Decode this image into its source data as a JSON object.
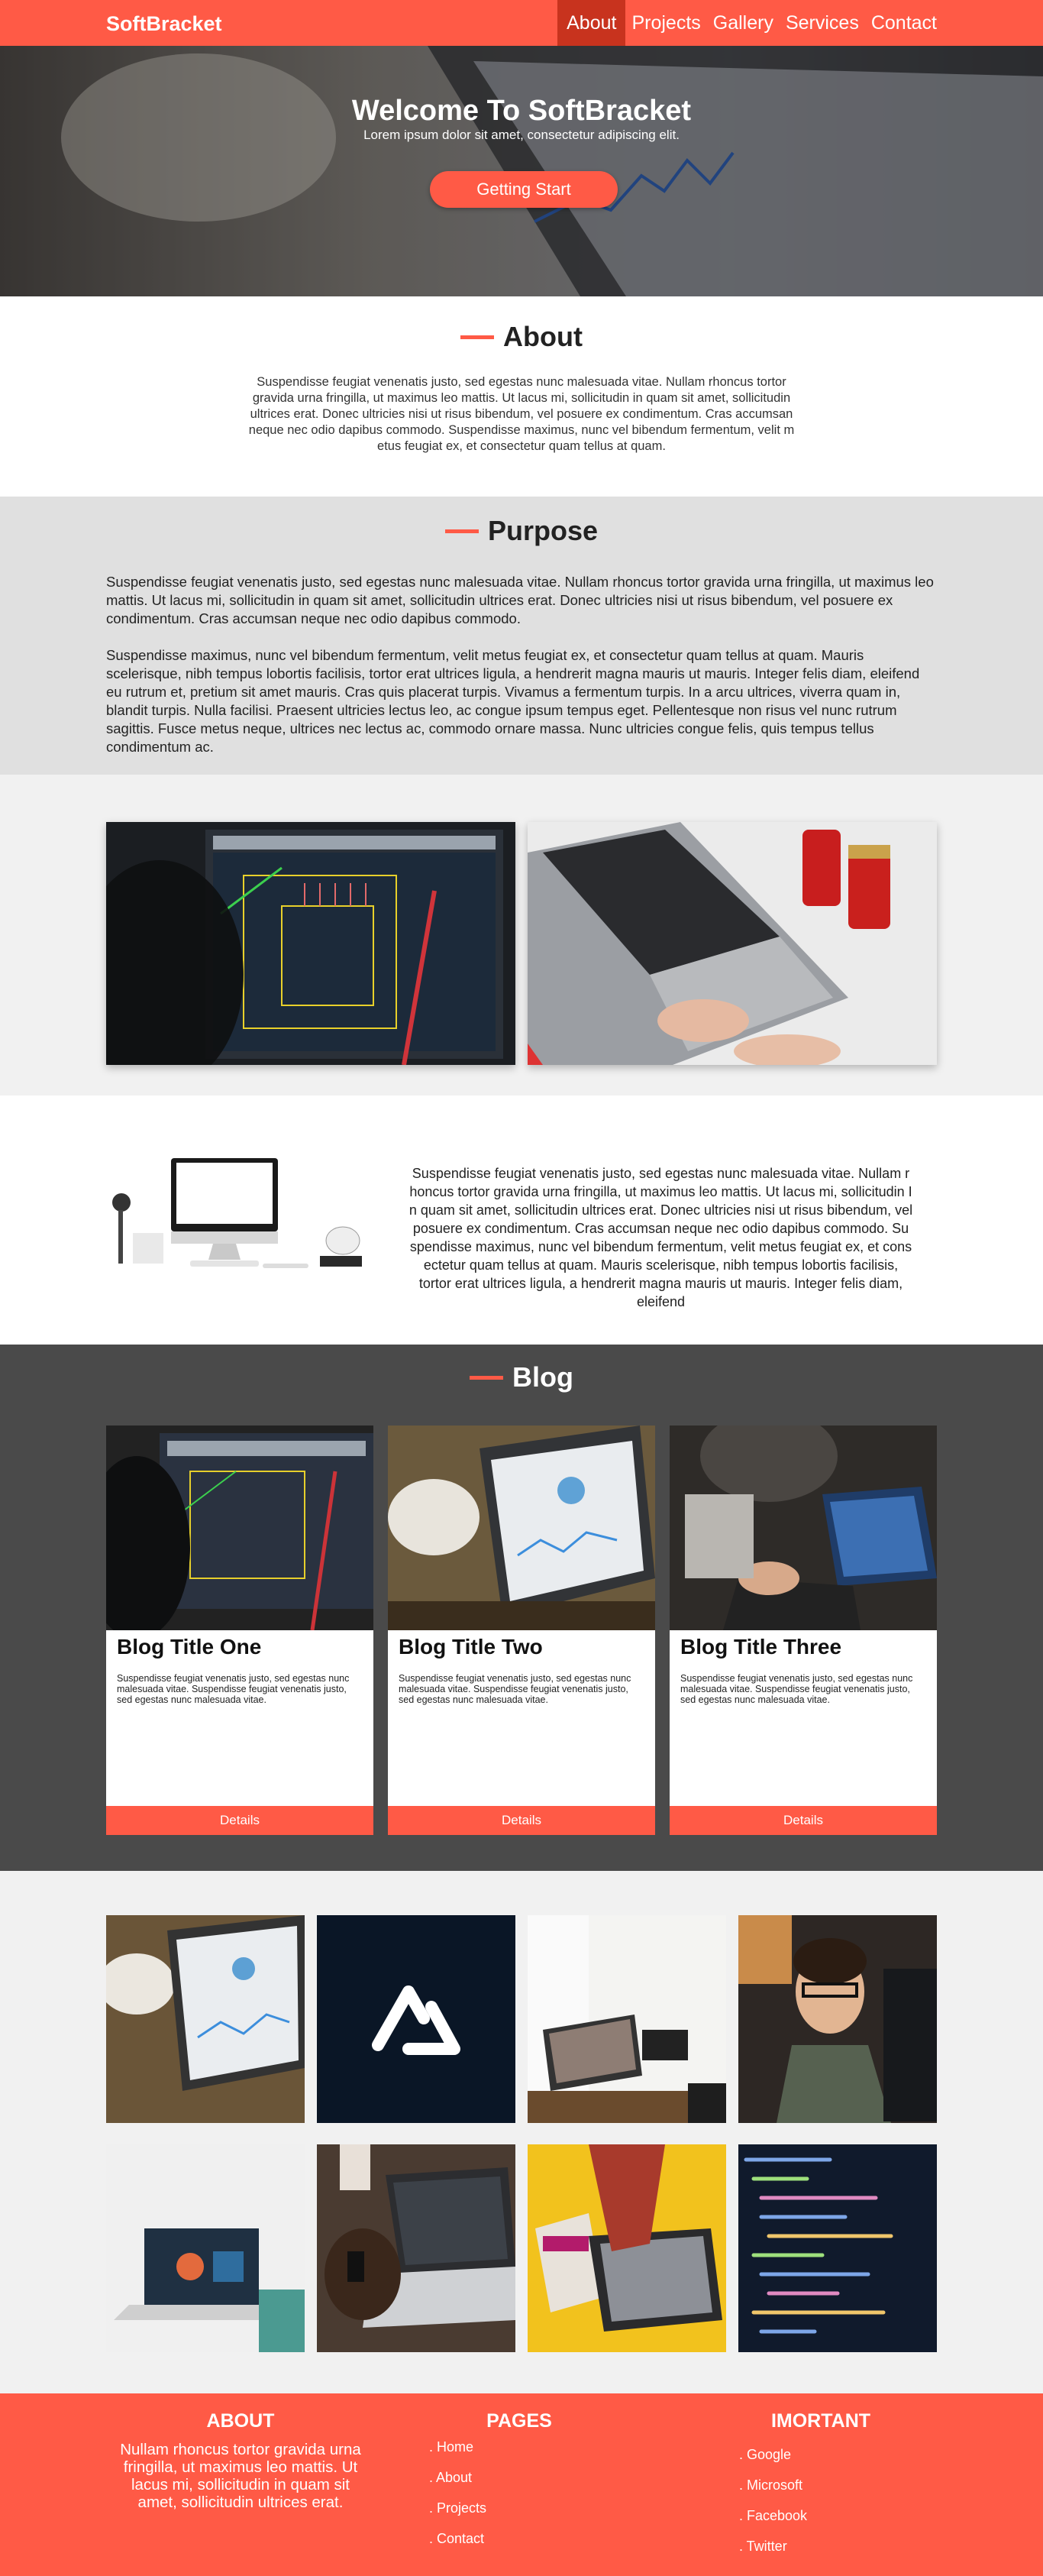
{
  "nav": {
    "brand": "SoftBracket",
    "items": [
      "About",
      "Projects",
      "Gallery",
      "Services",
      "Contact"
    ]
  },
  "hero": {
    "title": "Welcome To SoftBracket",
    "subtitle": "Lorem ipsum dolor sit amet, consectetur adipiscing elit.",
    "button": "Getting Start"
  },
  "about": {
    "title": "About",
    "text": "Suspendisse feugiat venenatis justo, sed egestas nunc malesuada vitae. Nullam rhoncus tortor gravida urna fringilla, ut maximus leo mattis. Ut lacus mi, sollicitudin in quam sit amet, sollicitudin ultrices erat. Donec ultricies nisi ut risus bibendum, vel posuere ex condimentum. Cras accumsan neque nec odio dapibus commodo. Suspendisse maximus, nunc vel bibendum fermentum, velit m etus feugiat ex, et consectetur quam tellus at quam."
  },
  "purpose": {
    "title": "Purpose",
    "p1": "Suspendisse feugiat venenatis justo, sed egestas nunc malesuada vitae. Nullam rhoncus tortor gravida urna fringilla, ut maximus leo mattis. Ut lacus mi, sollicitudin in quam sit amet, sollicitudin ultrices erat. Donec ultricies nisi ut risus bibendum, vel posuere ex condimentum. Cras accumsan neque nec odio dapibus commodo.",
    "p2": "Suspendisse maximus, nunc vel bibendum fermentum, velit metus feugiat ex, et consectetur quam tellus at quam. Mauris scelerisque, nibh tempus lobortis facilisis, tortor erat ultrices ligula, a hendrerit magna mauris ut mauris. Integer felis diam, eleifend eu rutrum et, pretium sit amet mauris. Cras quis placerat turpis. Vivamus a fermentum turpis. In a arcu ultrices, viverra quam in, blandit turpis. Nulla facilisi. Praesent ultricies lectus leo, ac congue ipsum tempus eget. Pellentesque non risus vel nunc rutrum sagittis. Fusce metus neque, ultrices nec lectus ac, commodo ornare massa. Nunc ultricies congue felis, quis tempus tellus condimentum ac."
  },
  "computer": {
    "text": "Suspendisse feugiat venenatis justo, sed egestas nunc malesuada vitae. Nullam r honcus tortor gravida urna fringilla, ut maximus leo mattis. Ut lacus mi, sollicitudin I n quam sit amet, sollicitudin ultrices erat. Donec ultricies nisi ut risus bibendum, vel posuere ex condimentum. Cras accumsan neque nec odio dapibus commodo. Su spendisse maximus, nunc vel bibendum fermentum, velit metus feugiat ex, et cons ectetur quam tellus at quam. Mauris scelerisque, nibh tempus lobortis facilisis, tortor erat ultrices ligula, a hendrerit magna mauris ut mauris. Integer felis diam, eleifend"
  },
  "blog": {
    "title": "Blog",
    "posts": [
      {
        "title": "Blog Title One",
        "text": "Suspendisse feugiat venenatis justo, sed egestas nunc malesuada vitae. Suspendisse feugiat venenatis justo, sed egestas nunc malesuada vitae.",
        "button": "Details"
      },
      {
        "title": "Blog Title Two",
        "text": "Suspendisse feugiat venenatis justo, sed egestas nunc malesuada vitae. Suspendisse feugiat venenatis justo, sed egestas nunc malesuada vitae.",
        "button": "Details"
      },
      {
        "title": "Blog Title Three",
        "text": "Suspendisse feugiat venenatis justo, sed egestas nunc malesuada vitae. Suspendisse feugiat venenatis justo, sed egestas nunc malesuada vitae.",
        "button": "Details"
      }
    ]
  },
  "footer": {
    "about_title": "ABOUT",
    "about_text": "Nullam rhoncus tortor gravida urna fringilla, ut maximus leo mattis. Ut lacus mi, sollicitudin in quam sit amet, sollicitudin ultrices erat.",
    "pages_title": "PAGES",
    "pages": [
      ". Home",
      ". About",
      ". Projects",
      ". Contact"
    ],
    "important_title": "IMORTANT",
    "important": [
      ". Google",
      ". Microsoft",
      ". Facebook",
      ". Twitter"
    ]
  },
  "colors": {
    "accent": "#ff5a46",
    "accent_dark": "#c8331e",
    "blog_bg": "#4a4a4a"
  }
}
